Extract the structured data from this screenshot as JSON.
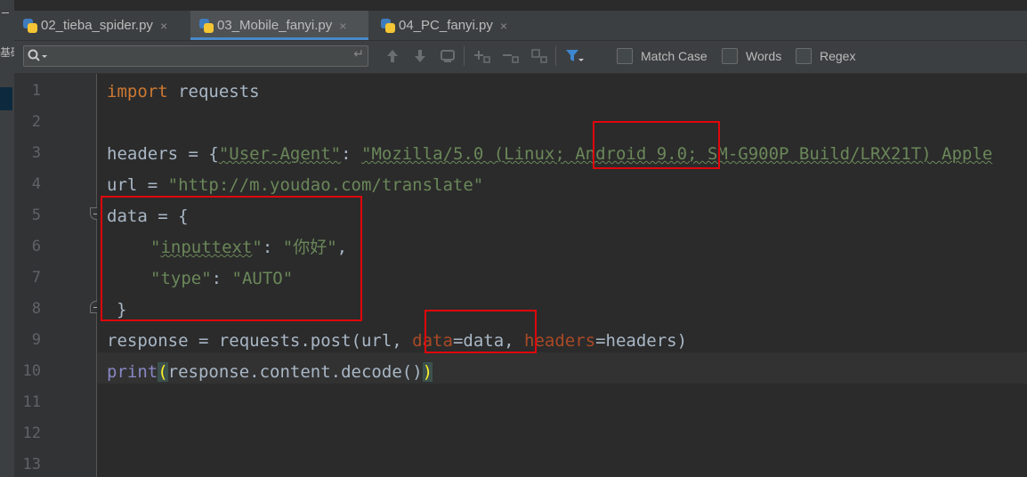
{
  "left_strip": {
    "glyph": "基础"
  },
  "tabs": [
    {
      "label": "02_tieba_spider.py",
      "close": "×"
    },
    {
      "label": "03_Mobile_fanyi.py",
      "close": "×"
    },
    {
      "label": "04_PC_fanyi.py",
      "close": "×"
    }
  ],
  "find": {
    "search_value": "",
    "enter_glyph": "↵",
    "match_case_label": "Match Case",
    "words_label": "Words",
    "regex_label": "Regex"
  },
  "editor": {
    "line_numbers": [
      "1",
      "2",
      "3",
      "4",
      "5",
      "6",
      "7",
      "8",
      "9",
      "10",
      "11",
      "12",
      "13"
    ],
    "code": {
      "l1_kw": "import",
      "l1_rest": " requests",
      "l3_a": "headers = {",
      "l3_str1": "\"User-Agent\"",
      "l3_colon": ": ",
      "l3_str2": "\"Mozilla/5.0 (Linux; Android 9.0; SM-G900P Build/LRX21T) Apple",
      "l4_a": "url = ",
      "l4_str": "\"http://m.youdao.com/translate\"",
      "l5": "data = {",
      "l6_q1": "\"",
      "l6_key": "inputtext",
      "l6_q2": "\"",
      "l6_colon": ": ",
      "l6_val": "\"你好\"",
      "l6_comma": ",",
      "l7_key": "\"type\"",
      "l7_colon": ": ",
      "l7_val": "\"AUTO\"",
      "l8": "}",
      "l9_a": "response = requests.post(url, ",
      "l9_param1": "data",
      "l9_b": "=data, ",
      "l9_param2": "headers",
      "l9_c": "=headers)",
      "l10_fn": "print",
      "l10_open": "(",
      "l10_mid": "response.content.decode()",
      "l10_close": ")"
    }
  },
  "colors": {
    "accent": "#4a88c7",
    "keyword": "#cc7832",
    "string": "#6a8759",
    "param": "#aa4926",
    "builtin": "#8888c6",
    "highlight_box": "#e0060c"
  }
}
